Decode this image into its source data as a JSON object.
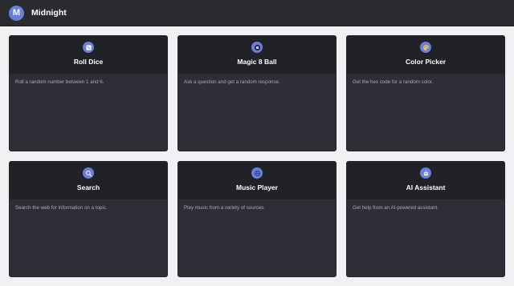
{
  "header": {
    "logo_letter": "M",
    "app_name": "Midnight"
  },
  "colors": {
    "accent": "#6b7fd8",
    "card_bg": "#2e2f36",
    "card_header_bg": "#212227",
    "topbar_bg": "#2a2b31"
  },
  "cards": [
    {
      "icon": "dice-icon",
      "title": "Roll Dice",
      "description": "Roll a random number between 1 and 6."
    },
    {
      "icon": "magic-8-ball-icon",
      "title": "Magic 8 Ball",
      "description": "Ask a question and get a random response."
    },
    {
      "icon": "palette-icon",
      "title": "Color Picker",
      "description": "Get the hex code for a random color."
    },
    {
      "icon": "search-icon",
      "title": "Search",
      "description": "Search the web for information on a topic."
    },
    {
      "icon": "globe-icon",
      "title": "Music Player",
      "description": "Play music from a variety of sources."
    },
    {
      "icon": "robot-icon",
      "title": "AI Assistant",
      "description": "Get help from an AI-powered assistant."
    }
  ]
}
